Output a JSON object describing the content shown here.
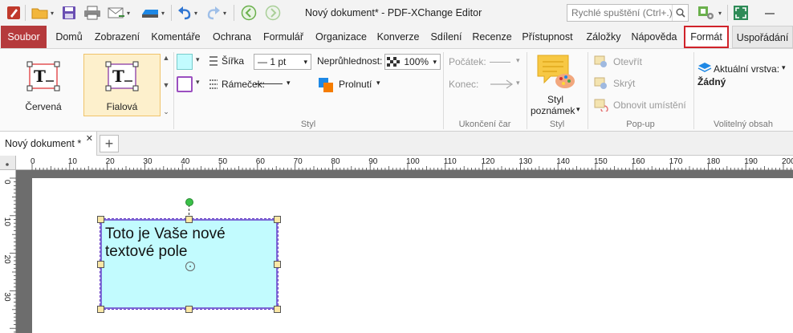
{
  "window": {
    "title": "Nový dokument* - PDF-XChange Editor",
    "search_placeholder": "Rychlé spuštění (Ctrl+.)"
  },
  "menu": {
    "tabs": [
      "Soubor",
      "Domů",
      "Zobrazení",
      "Komentáře",
      "Ochrana",
      "Formulář",
      "Organizace",
      "Konverze",
      "Sdílení",
      "Recenze",
      "Přístupnost",
      "Záložky",
      "Nápověda",
      "Formát",
      "Uspořádání"
    ],
    "active": "Formát"
  },
  "ribbon": {
    "styles": [
      {
        "name": "Červená",
        "color": "#e0393b"
      },
      {
        "name": "Fialová",
        "color": "#8a3ca6"
      }
    ],
    "styl_group": {
      "width_label": "Šířka",
      "width_value": "— 1 pt",
      "border_label": "Rámeček:",
      "opacity_label": "Neprůhlednost:",
      "opacity_value": "100%",
      "blend_label": "Prolnutí",
      "fill_color": "#c2fbfe",
      "stroke_color": "#9b4fc0",
      "group_name": "Styl"
    },
    "line_end": {
      "start_label": "Počátek:",
      "end_label": "Konec:",
      "group_name": "Ukončení čar"
    },
    "note_style": {
      "label_line1": "Styl",
      "label_line2": "poznámek",
      "group_name": "Styl"
    },
    "popup": {
      "open": "Otevřít",
      "hide": "Skrýt",
      "restore": "Obnovit umístění",
      "group_name": "Pop-up"
    },
    "optional": {
      "layer_label": "Aktuální vrstva:",
      "layer_value": "Žádný",
      "group_name": "Volitelný obsah"
    }
  },
  "document": {
    "tab_title": "Nový dokument *",
    "textbox_text": "Toto je Vaše nové textové pole"
  },
  "ruler": {
    "h_ticks": [
      "0",
      "10",
      "20",
      "30",
      "40",
      "50",
      "60",
      "70",
      "80",
      "90",
      "100",
      "110",
      "120",
      "130",
      "140",
      "150",
      "160",
      "170",
      "180",
      "190",
      "200"
    ],
    "v_ticks": [
      "0",
      "10",
      "20",
      "30"
    ]
  },
  "colors": {
    "accent_file": "#b53a3c",
    "highlight": "#d0232a"
  }
}
